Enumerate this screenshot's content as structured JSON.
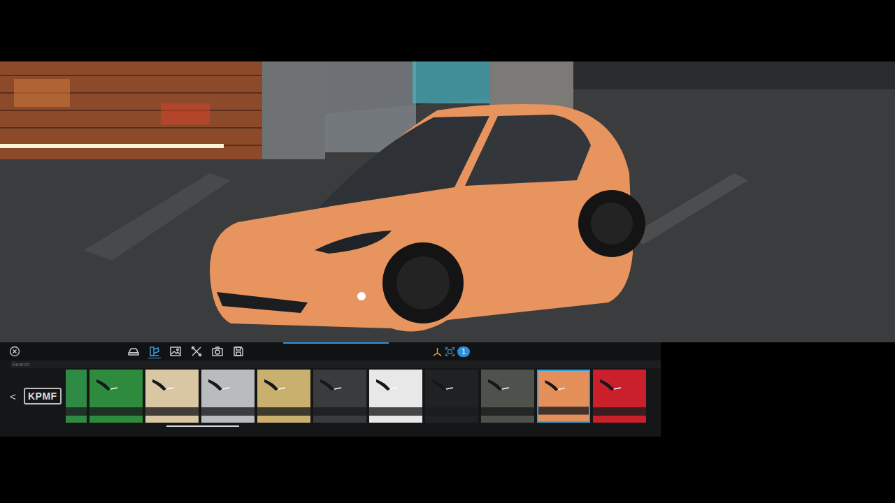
{
  "scene": {
    "selected_color": "#e8945e"
  },
  "toolbar": {
    "tools": [
      {
        "kind": "car",
        "selected": false
      },
      {
        "kind": "paint",
        "selected": true
      },
      {
        "kind": "image",
        "selected": false
      },
      {
        "kind": "tools",
        "selected": false
      },
      {
        "kind": "camera",
        "selected": false
      },
      {
        "kind": "save",
        "selected": false
      }
    ],
    "progress": {
      "level": 0.16
    },
    "view_badge": "1"
  },
  "search": {
    "placeholder": "Search"
  },
  "back": "<",
  "brand": "KPMF",
  "swatches": [
    {
      "color": "#2f8a45",
      "selected": false
    },
    {
      "color": "#2e8b3e",
      "selected": false
    },
    {
      "color": "#d9c7a3",
      "selected": false
    },
    {
      "color": "#b9bcbe",
      "selected": false
    },
    {
      "color": "#c9b06e",
      "selected": false
    },
    {
      "color": "#3a3b3c",
      "selected": false
    },
    {
      "color": "#e8e8e8",
      "selected": false
    },
    {
      "color": "#202122",
      "selected": false
    },
    {
      "color": "#4d534c",
      "selected": false
    },
    {
      "color": "#e58f5a",
      "selected": true
    },
    {
      "color": "#c9202c",
      "selected": false
    }
  ],
  "swatch_scroll": {
    "level": 0.13
  }
}
